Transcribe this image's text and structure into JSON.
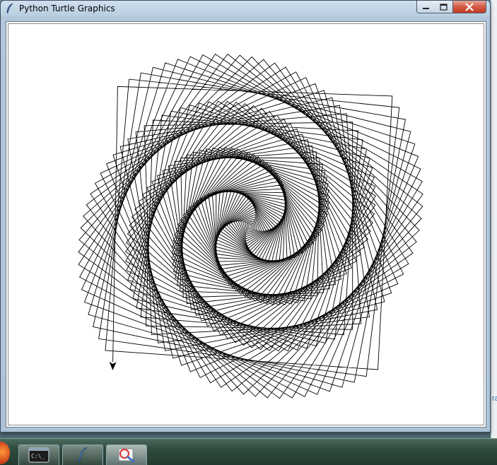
{
  "window": {
    "title": "Python Turtle Graphics",
    "icon": "feather-icon",
    "controls": {
      "minimize": "minimize-icon",
      "maximize": "maximize-icon",
      "close": "close-icon"
    }
  },
  "canvas": {
    "background": "#ffffff",
    "pen_color": "#000000",
    "figure": "square-spiral"
  },
  "taskbar": {
    "items": [
      {
        "name": "start-orb",
        "icon": "windows-orb-icon"
      },
      {
        "name": "terminal",
        "icon": "terminal-icon"
      },
      {
        "name": "python-idle",
        "icon": "feather-icon"
      },
      {
        "name": "paint",
        "icon": "paint-icon"
      }
    ]
  },
  "colors": {
    "titlebar": "#b9cde0",
    "close_button": "#c94a30",
    "taskbar": "#2f4a3e"
  }
}
